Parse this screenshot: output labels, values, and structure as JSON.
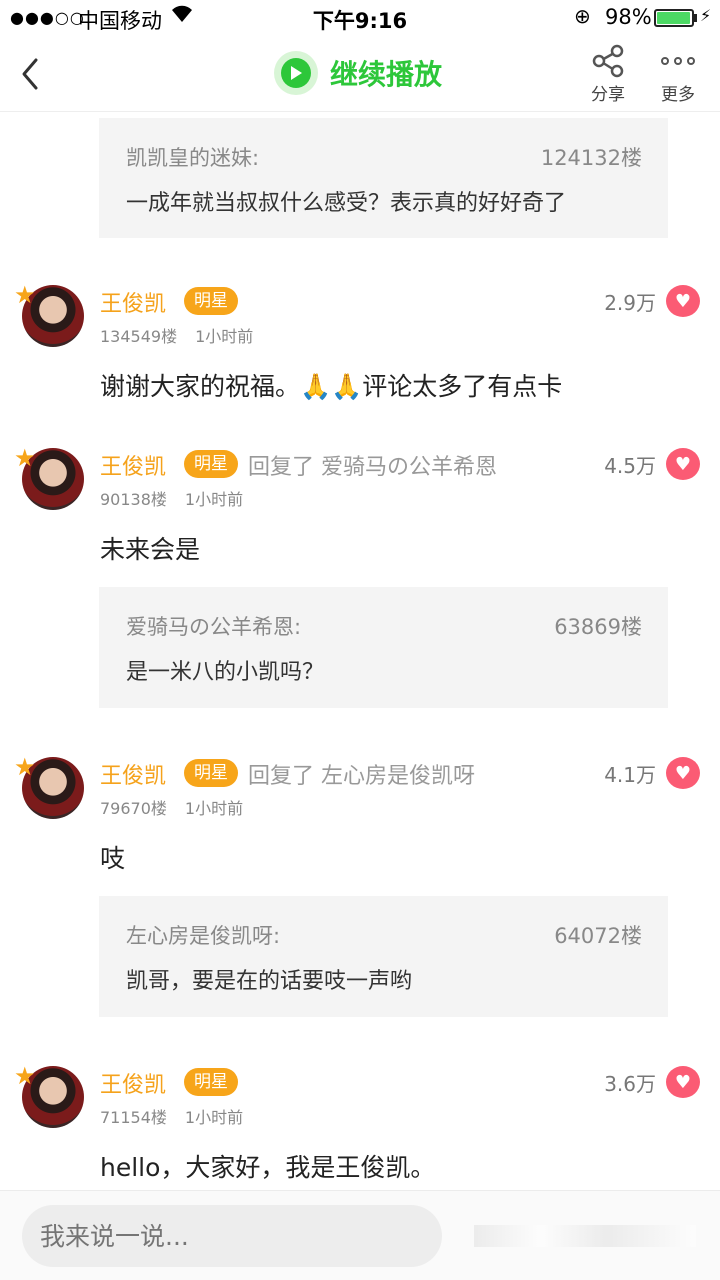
{
  "status_bar": {
    "signal": "●●●○○",
    "carrier": "中国移动",
    "time": "下午9:16",
    "battery_percent": "98%",
    "battery_level": 0.98
  },
  "nav": {
    "play_label": "继续播放",
    "share_label": "分享",
    "more_label": "更多"
  },
  "quoted_top": {
    "author": "凯凯皇的迷妹:",
    "floor": "124132楼",
    "text": "一成年就当叔叔什么感受？表示真的好好奇了"
  },
  "comments": [
    {
      "name": "王俊凯",
      "badge": "明星",
      "reply_to": "",
      "likes": "2.9万",
      "floor": "134549楼",
      "time": "1小时前",
      "text": "谢谢大家的祝福。🙏🙏评论太多了有点卡"
    },
    {
      "name": "王俊凯",
      "badge": "明星",
      "reply_to": "回复了 爱骑马の公羊希恩",
      "likes": "4.5万",
      "floor": "90138楼",
      "time": "1小时前",
      "text": "未来会是",
      "quote": {
        "author": "爱骑马の公羊希恩:",
        "floor": "63869楼",
        "text": "是一米八的小凯吗？"
      }
    },
    {
      "name": "王俊凯",
      "badge": "明星",
      "reply_to": "回复了 左心房是俊凯呀",
      "likes": "4.1万",
      "floor": "79670楼",
      "time": "1小时前",
      "text": "吱",
      "quote": {
        "author": "左心房是俊凯呀:",
        "floor": "64072楼",
        "text": "凯哥，要是在的话要吱一声哟"
      }
    },
    {
      "name": "王俊凯",
      "badge": "明星",
      "reply_to": "",
      "likes": "3.6万",
      "floor": "71154楼",
      "time": "1小时前",
      "text": "hello，大家好，我是王俊凯。"
    }
  ],
  "input": {
    "placeholder": "我来说一说..."
  },
  "colors": {
    "accent_green": "#2dc73a",
    "name_orange": "#f5a21b",
    "heart_red": "#fb5b74"
  }
}
